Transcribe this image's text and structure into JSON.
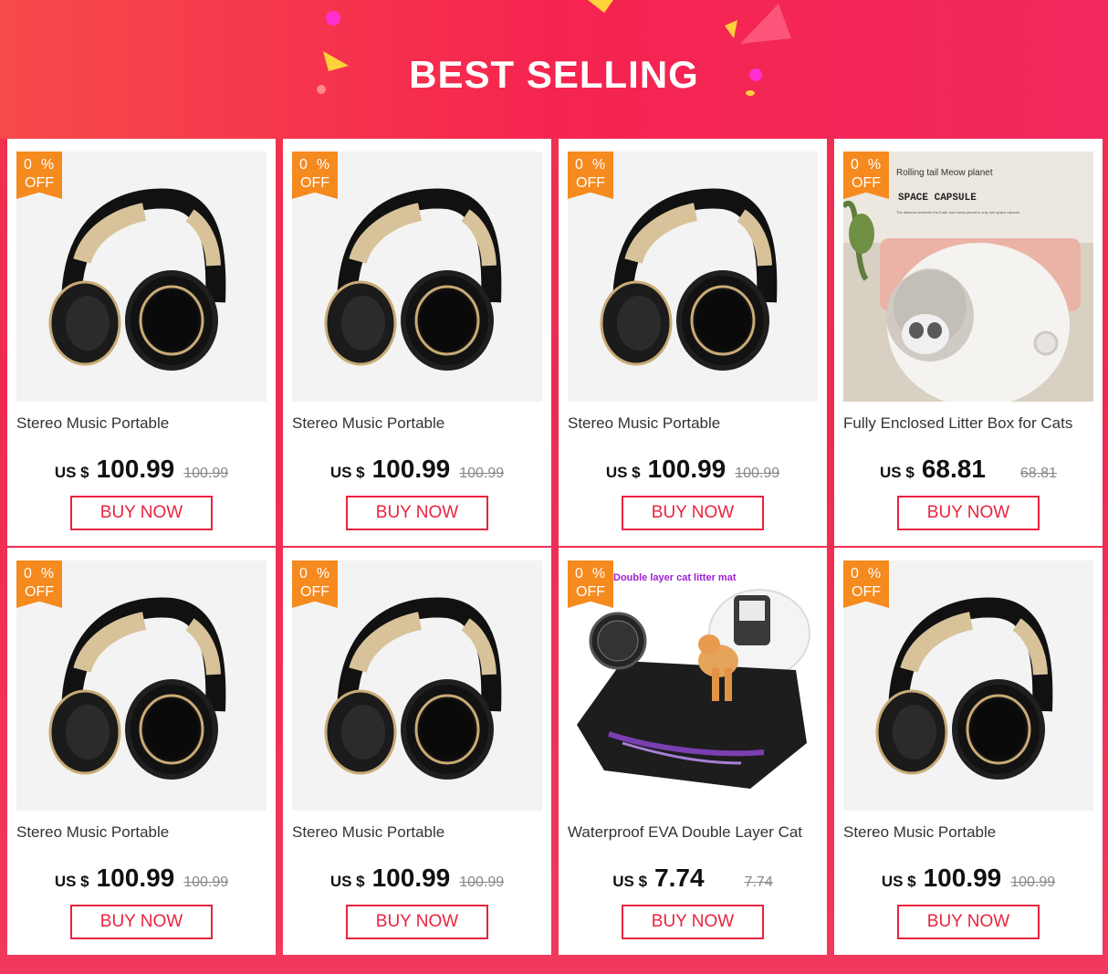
{
  "banner": {
    "title": "BEST SELLING"
  },
  "products": [
    {
      "discount_value": "0",
      "discount_unit": "%",
      "off_label": "OFF",
      "image": "headphones",
      "title": "Stereo Music Portable",
      "currency": "US $",
      "price": "100.99",
      "old_price": "100.99",
      "button": "BUY NOW"
    },
    {
      "discount_value": "0",
      "discount_unit": "%",
      "off_label": "OFF",
      "image": "headphones",
      "title": "Stereo Music Portable",
      "currency": "US $",
      "price": "100.99",
      "old_price": "100.99",
      "button": "BUY NOW"
    },
    {
      "discount_value": "0",
      "discount_unit": "%",
      "off_label": "OFF",
      "image": "headphones",
      "title": "Stereo Music Portable",
      "currency": "US $",
      "price": "100.99",
      "old_price": "100.99",
      "button": "BUY NOW"
    },
    {
      "discount_value": "0",
      "discount_unit": "%",
      "off_label": "OFF",
      "image": "litter-box",
      "title": "Fully Enclosed Litter Box for Cats",
      "currency": "US $",
      "price": "68.81",
      "old_price": "68.81",
      "button": "BUY NOW",
      "image_text": {
        "line1": "Rolling tail Meow planet",
        "line2": "SPACE CAPSULE",
        "line3": "The distance between the Earth and meow planet is only one space capsule."
      }
    },
    {
      "discount_value": "0",
      "discount_unit": "%",
      "off_label": "OFF",
      "image": "headphones",
      "title": "Stereo Music Portable",
      "currency": "US $",
      "price": "100.99",
      "old_price": "100.99",
      "button": "BUY NOW"
    },
    {
      "discount_value": "0",
      "discount_unit": "%",
      "off_label": "OFF",
      "image": "headphones",
      "title": "Stereo Music Portable",
      "currency": "US $",
      "price": "100.99",
      "old_price": "100.99",
      "button": "BUY NOW"
    },
    {
      "discount_value": "0",
      "discount_unit": "%",
      "off_label": "OFF",
      "image": "litter-mat",
      "title": "Waterproof EVA Double Layer Cat",
      "currency": "US $",
      "price": "7.74",
      "old_price": "7.74",
      "button": "BUY NOW",
      "image_text": {
        "line1": "Double layer cat litter mat"
      }
    },
    {
      "discount_value": "0",
      "discount_unit": "%",
      "off_label": "OFF",
      "image": "headphones",
      "title": "Stereo Music Portable",
      "currency": "US $",
      "price": "100.99",
      "old_price": "100.99",
      "button": "BUY NOW"
    }
  ]
}
